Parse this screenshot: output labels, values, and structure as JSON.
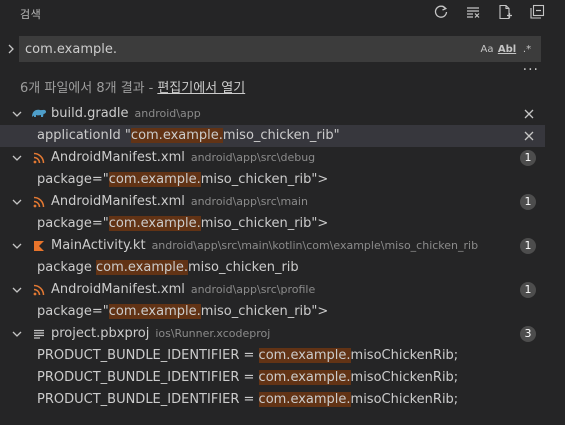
{
  "header": {
    "title": "검색",
    "refresh_icon": "refresh-icon",
    "clear_icon": "clear-results-icon",
    "new_editor_icon": "new-search-editor-icon",
    "collapse_icon": "collapse-all-icon"
  },
  "search": {
    "value": "com.example.",
    "options": [
      "Aa",
      "Abl",
      ".*"
    ]
  },
  "more_label": "···",
  "summary": {
    "text": "6개 파일에서 8개 결과",
    "separator": "-",
    "link": "편집기에서 열기"
  },
  "colors": {
    "background": "#252526",
    "input_background": "#3c3c3c",
    "highlight": "#623315",
    "selected_row": "#37373d",
    "gradle_icon": "#4e9ec9",
    "xml_icon": "#e37933",
    "kotlin_icon": "#e8742b"
  },
  "results": [
    {
      "file": "build.gradle",
      "path": "android\\app",
      "icon": "gradle-icon",
      "action": "dismiss",
      "matches": [
        {
          "before": "applicationId \"",
          "match": "com.example.",
          "after": "miso_chicken_rib\"",
          "selected": true
        }
      ]
    },
    {
      "file": "AndroidManifest.xml",
      "path": "android\\app\\src\\debug",
      "icon": "rss-xml-icon",
      "count": "1",
      "matches": [
        {
          "before": "package=\"",
          "match": "com.example.",
          "after": "miso_chicken_rib\">"
        }
      ]
    },
    {
      "file": "AndroidManifest.xml",
      "path": "android\\app\\src\\main",
      "icon": "rss-xml-icon",
      "count": "1",
      "matches": [
        {
          "before": "package=\"",
          "match": "com.example.",
          "after": "miso_chicken_rib\">"
        }
      ]
    },
    {
      "file": "MainActivity.kt",
      "path": "android\\app\\src\\main\\kotlin\\com\\example\\miso_chicken_rib",
      "icon": "kotlin-icon",
      "count": "1",
      "matches": [
        {
          "before": "package ",
          "match": "com.example.",
          "after": "miso_chicken_rib"
        }
      ]
    },
    {
      "file": "AndroidManifest.xml",
      "path": "android\\app\\src\\profile",
      "icon": "rss-xml-icon",
      "count": "1",
      "matches": [
        {
          "before": "package=\"",
          "match": "com.example.",
          "after": "miso_chicken_rib\">"
        }
      ]
    },
    {
      "file": "project.pbxproj",
      "path": "ios\\Runner.xcodeproj",
      "icon": "lines-file-icon",
      "count": "3",
      "matches": [
        {
          "before": "PRODUCT_BUNDLE_IDENTIFIER = ",
          "match": "com.example.",
          "after": "misoChickenRib;"
        },
        {
          "before": "PRODUCT_BUNDLE_IDENTIFIER = ",
          "match": "com.example.",
          "after": "misoChickenRib;"
        },
        {
          "before": "PRODUCT_BUNDLE_IDENTIFIER = ",
          "match": "com.example.",
          "after": "misoChickenRib;"
        }
      ]
    }
  ]
}
